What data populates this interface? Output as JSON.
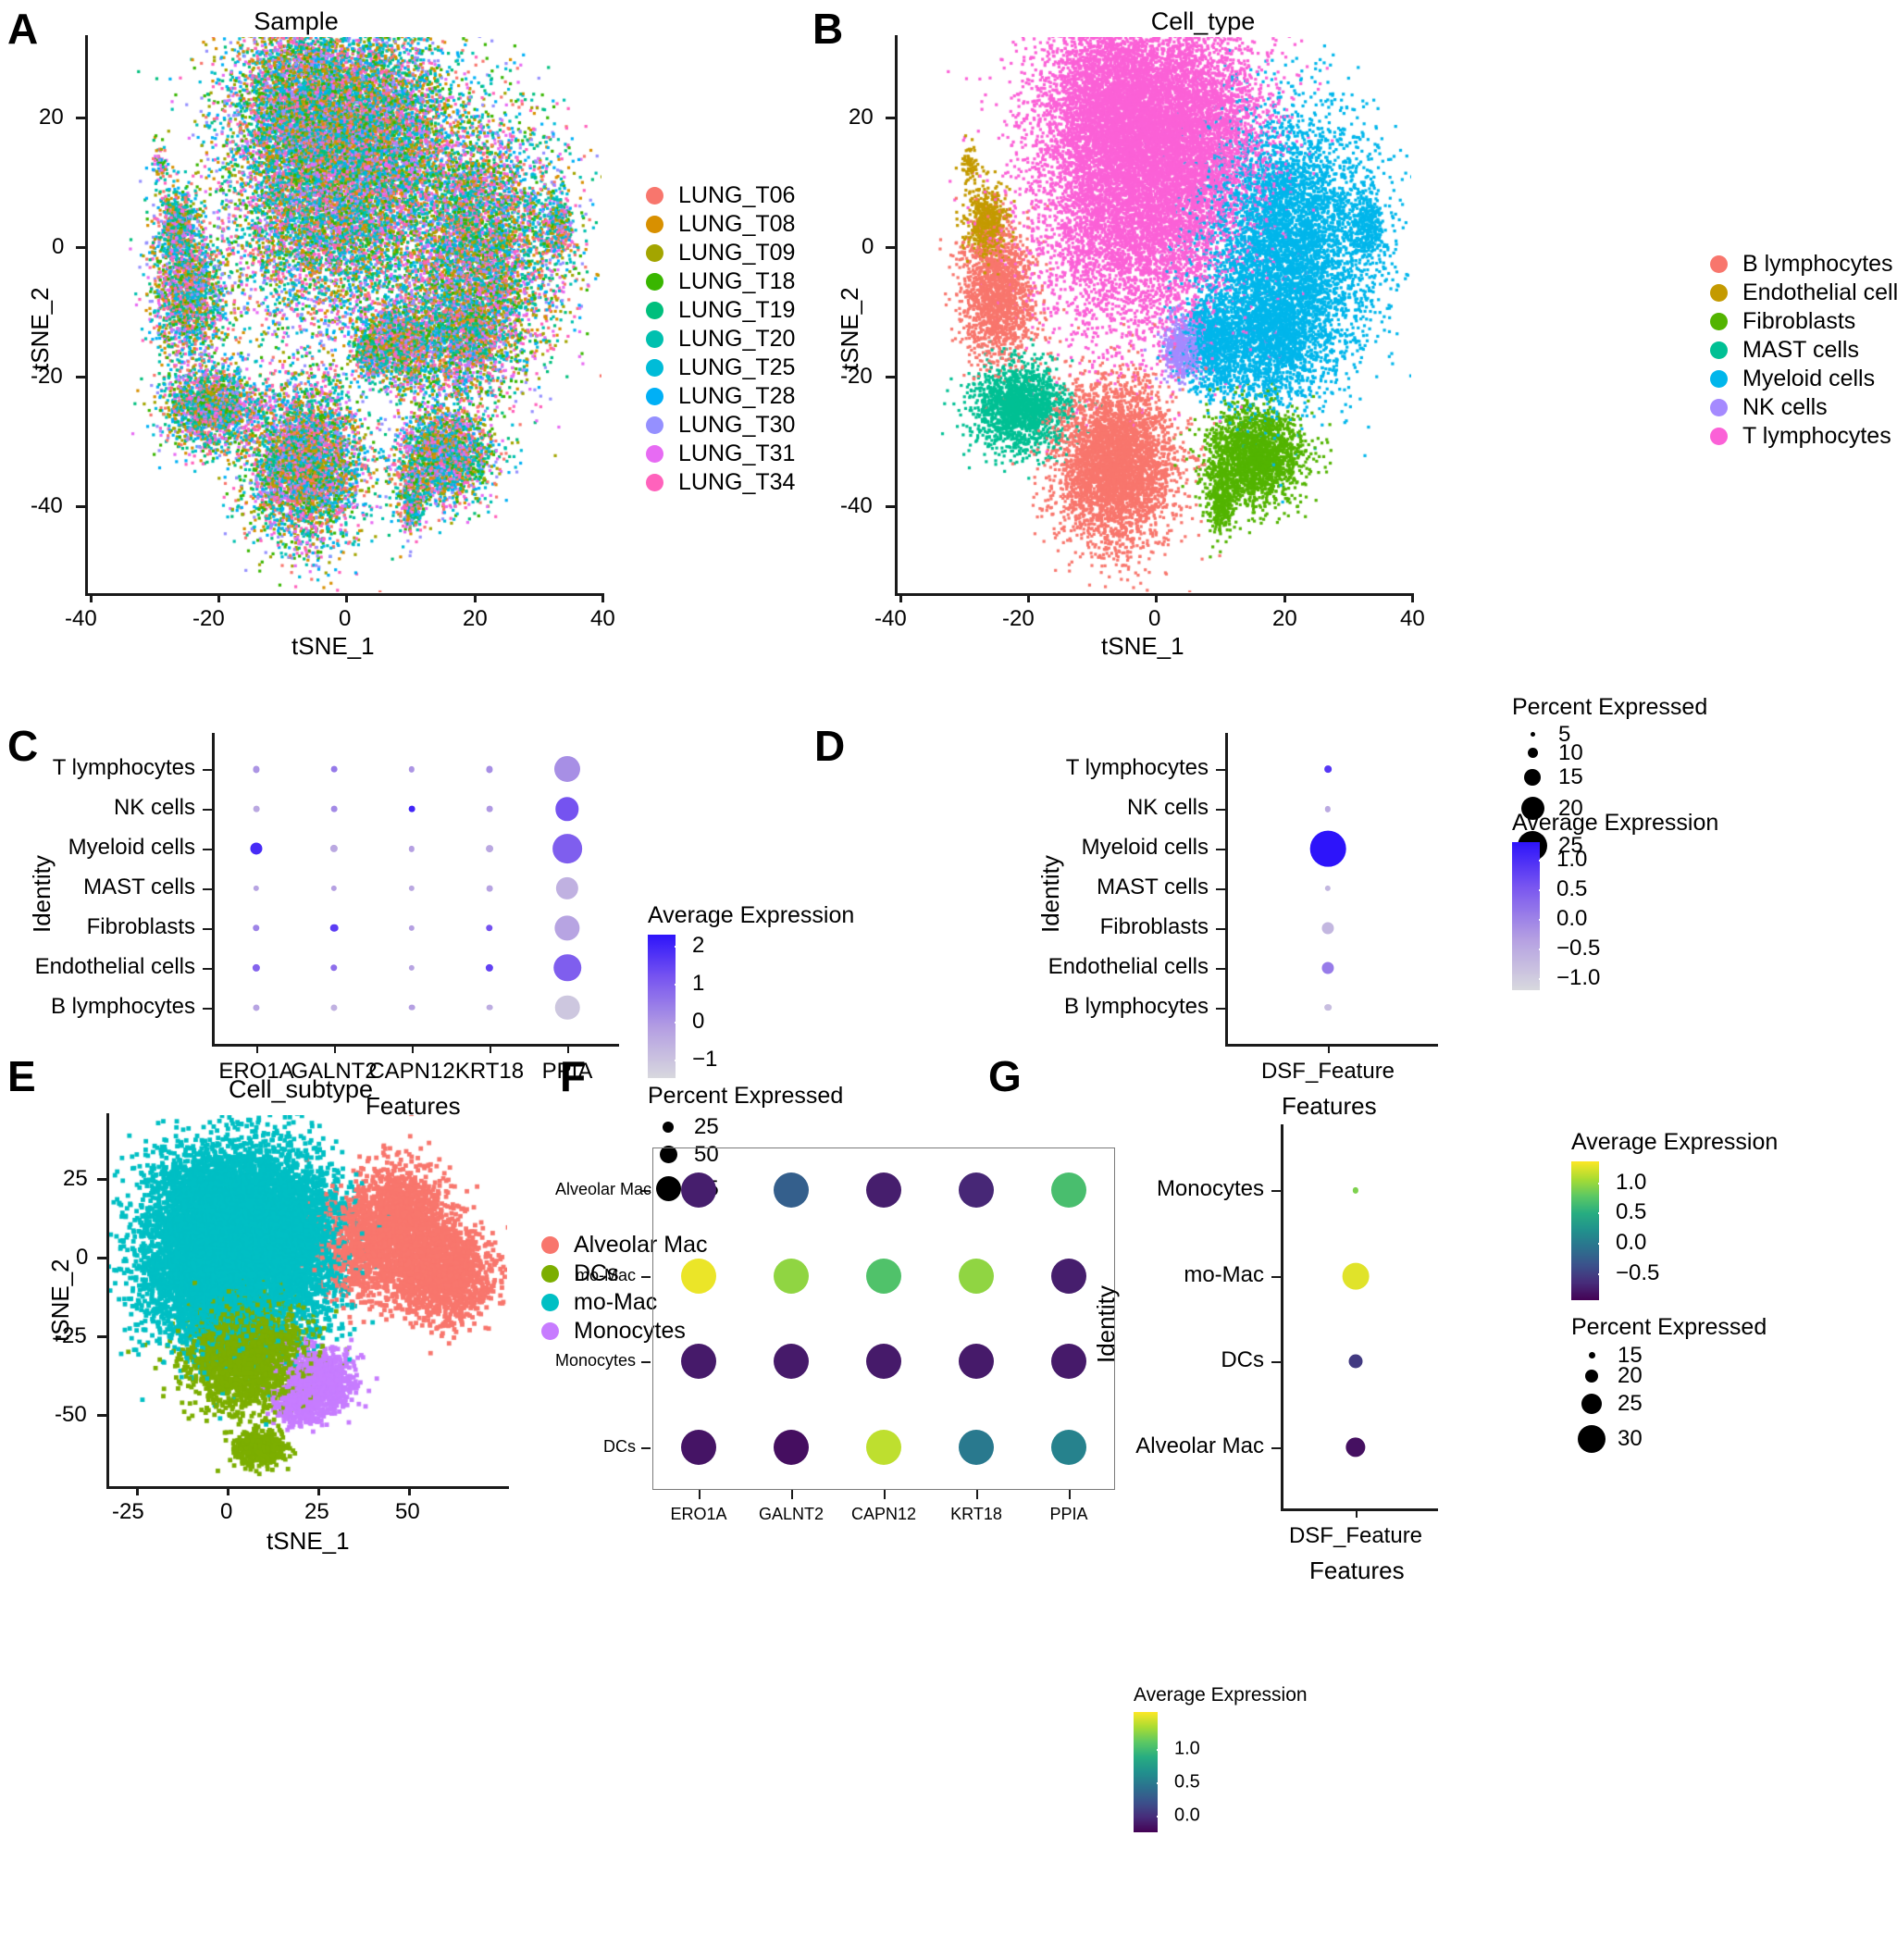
{
  "figure": {
    "panels": [
      "A",
      "B",
      "C",
      "D",
      "E",
      "F",
      "G"
    ]
  },
  "panelA": {
    "letter": "A",
    "title": "Sample",
    "xlabel": "tSNE_1",
    "ylabel": "tSNE_2",
    "xticks": [
      "-40",
      "-20",
      "0",
      "20",
      "40"
    ],
    "yticks": [
      "20",
      "0",
      "-20",
      "-40"
    ],
    "legend_items": [
      {
        "label": "LUNG_T06",
        "color": "#F8766D"
      },
      {
        "label": "LUNG_T08",
        "color": "#D89000"
      },
      {
        "label": "LUNG_T09",
        "color": "#A3A500"
      },
      {
        "label": "LUNG_T18",
        "color": "#39B600"
      },
      {
        "label": "LUNG_T19",
        "color": "#00BF7D"
      },
      {
        "label": "LUNG_T20",
        "color": "#00C0AF"
      },
      {
        "label": "LUNG_T25",
        "color": "#00BCD8"
      },
      {
        "label": "LUNG_T28",
        "color": "#00B0F6"
      },
      {
        "label": "LUNG_T30",
        "color": "#9590FF"
      },
      {
        "label": "LUNG_T31",
        "color": "#E76BF3"
      },
      {
        "label": "LUNG_T34",
        "color": "#FF62BC"
      }
    ]
  },
  "panelB": {
    "letter": "B",
    "title": "Cell_type",
    "xlabel": "tSNE_1",
    "ylabel": "tSNE_2",
    "xticks": [
      "-40",
      "-20",
      "0",
      "20",
      "40"
    ],
    "yticks": [
      "20",
      "0",
      "-20",
      "-40"
    ],
    "legend_items": [
      {
        "label": "B lymphocytes",
        "color": "#F8766D"
      },
      {
        "label": "Endothelial cells",
        "color": "#C49A00"
      },
      {
        "label": "Fibroblasts",
        "color": "#53B400"
      },
      {
        "label": "MAST cells",
        "color": "#00C094"
      },
      {
        "label": "Myeloid cells",
        "color": "#00B6EB"
      },
      {
        "label": "NK cells",
        "color": "#A58AFF"
      },
      {
        "label": "T lymphocytes",
        "color": "#FB61D7"
      }
    ]
  },
  "panelC": {
    "letter": "C",
    "xlabel": "Features",
    "ylabel": "Identity",
    "features": [
      "ERO1A",
      "GALNT2",
      "CAPN12",
      "KRT18",
      "PPIA"
    ],
    "identities": [
      "B lymphocytes",
      "Endothelial cells",
      "Fibroblasts",
      "MAST cells",
      "Myeloid cells",
      "NK cells",
      "T lymphocytes"
    ],
    "color_legend_title": "Average Expression",
    "color_ticks": [
      "2",
      "1",
      "0",
      "-1"
    ],
    "color_range": [
      -1.5,
      2.3
    ],
    "size_legend_title": "Percent Expressed",
    "size_legend_values": [
      "25",
      "50",
      "75"
    ],
    "dots": [
      {
        "identity": "T lymphocytes",
        "feature": "ERO1A",
        "avg": 0.0,
        "pct": 6
      },
      {
        "identity": "T lymphocytes",
        "feature": "GALNT2",
        "avg": 0.5,
        "pct": 5
      },
      {
        "identity": "T lymphocytes",
        "feature": "CAPN12",
        "avg": 0.0,
        "pct": 4
      },
      {
        "identity": "T lymphocytes",
        "feature": "KRT18",
        "avg": 0.1,
        "pct": 6
      },
      {
        "identity": "T lymphocytes",
        "feature": "PPIA",
        "avg": 0.1,
        "pct": 62
      },
      {
        "identity": "NK cells",
        "feature": "ERO1A",
        "avg": -0.4,
        "pct": 5
      },
      {
        "identity": "NK cells",
        "feature": "GALNT2",
        "avg": 0.2,
        "pct": 5
      },
      {
        "identity": "NK cells",
        "feature": "CAPN12",
        "avg": 2.0,
        "pct": 5
      },
      {
        "identity": "NK cells",
        "feature": "KRT18",
        "avg": -0.1,
        "pct": 5
      },
      {
        "identity": "NK cells",
        "feature": "PPIA",
        "avg": 1.2,
        "pct": 55
      },
      {
        "identity": "Myeloid cells",
        "feature": "ERO1A",
        "avg": 1.9,
        "pct": 22
      },
      {
        "identity": "Myeloid cells",
        "feature": "GALNT2",
        "avg": -0.4,
        "pct": 9
      },
      {
        "identity": "Myeloid cells",
        "feature": "CAPN12",
        "avg": -0.2,
        "pct": 4
      },
      {
        "identity": "Myeloid cells",
        "feature": "KRT18",
        "avg": -0.4,
        "pct": 8
      },
      {
        "identity": "Myeloid cells",
        "feature": "PPIA",
        "avg": 1.0,
        "pct": 72
      },
      {
        "identity": "MAST cells",
        "feature": "ERO1A",
        "avg": -0.3,
        "pct": 4
      },
      {
        "identity": "MAST cells",
        "feature": "GALNT2",
        "avg": -0.2,
        "pct": 4
      },
      {
        "identity": "MAST cells",
        "feature": "CAPN12",
        "avg": -0.4,
        "pct": 4
      },
      {
        "identity": "MAST cells",
        "feature": "KRT18",
        "avg": -0.3,
        "pct": 5
      },
      {
        "identity": "MAST cells",
        "feature": "PPIA",
        "avg": -0.6,
        "pct": 52
      },
      {
        "identity": "Fibroblasts",
        "feature": "ERO1A",
        "avg": 0.3,
        "pct": 7
      },
      {
        "identity": "Fibroblasts",
        "feature": "GALNT2",
        "avg": 1.6,
        "pct": 10
      },
      {
        "identity": "Fibroblasts",
        "feature": "CAPN12",
        "avg": -0.2,
        "pct": 4
      },
      {
        "identity": "Fibroblasts",
        "feature": "KRT18",
        "avg": 1.2,
        "pct": 7
      },
      {
        "identity": "Fibroblasts",
        "feature": "PPIA",
        "avg": -0.3,
        "pct": 60
      },
      {
        "identity": "Endothelial cells",
        "feature": "ERO1A",
        "avg": 0.9,
        "pct": 9
      },
      {
        "identity": "Endothelial cells",
        "feature": "GALNT2",
        "avg": 0.7,
        "pct": 7
      },
      {
        "identity": "Endothelial cells",
        "feature": "CAPN12",
        "avg": -0.3,
        "pct": 4
      },
      {
        "identity": "Endothelial cells",
        "feature": "KRT18",
        "avg": 1.5,
        "pct": 9
      },
      {
        "identity": "Endothelial cells",
        "feature": "PPIA",
        "avg": 1.0,
        "pct": 66
      },
      {
        "identity": "B lymphocytes",
        "feature": "ERO1A",
        "avg": -0.3,
        "pct": 6
      },
      {
        "identity": "B lymphocytes",
        "feature": "GALNT2",
        "avg": -0.6,
        "pct": 6
      },
      {
        "identity": "B lymphocytes",
        "feature": "CAPN12",
        "avg": -0.2,
        "pct": 5
      },
      {
        "identity": "B lymphocytes",
        "feature": "KRT18",
        "avg": -0.5,
        "pct": 5
      },
      {
        "identity": "B lymphocytes",
        "feature": "PPIA",
        "avg": -1.1,
        "pct": 58
      }
    ]
  },
  "panelD": {
    "letter": "D",
    "xlabel": "Features",
    "ylabel": "Identity",
    "features": [
      "DSF_Feature"
    ],
    "identities": [
      "B lymphocytes",
      "Endothelial cells",
      "Fibroblasts",
      "MAST cells",
      "Myeloid cells",
      "NK cells",
      "T lymphocytes"
    ],
    "size_legend_title": "Percent Expressed",
    "size_legend_values": [
      "5",
      "10",
      "15",
      "20",
      "25"
    ],
    "color_legend_title": "Average Expression",
    "color_ticks": [
      "1.0",
      "0.5",
      "0.0",
      "-0.5",
      "-1.0"
    ],
    "color_range": [
      -1.2,
      1.3
    ],
    "dots": [
      {
        "identity": "T lymphocytes",
        "avg": 0.9,
        "pct": 3
      },
      {
        "identity": "NK cells",
        "avg": -0.5,
        "pct": 2
      },
      {
        "identity": "Myeloid cells",
        "avg": 1.3,
        "pct": 26
      },
      {
        "identity": "MAST cells",
        "avg": -0.7,
        "pct": 2
      },
      {
        "identity": "Fibroblasts",
        "avg": -0.7,
        "pct": 7
      },
      {
        "identity": "Endothelial cells",
        "avg": 0.1,
        "pct": 7
      },
      {
        "identity": "B lymphocytes",
        "avg": -0.8,
        "pct": 3
      }
    ]
  },
  "panelE": {
    "letter": "E",
    "title": "Cell_subtype",
    "xlabel": "tSNE_1",
    "ylabel": "tSNE_2",
    "xticks": [
      "-25",
      "0",
      "25",
      "50"
    ],
    "yticks": [
      "25",
      "0",
      "-25",
      "-50"
    ],
    "legend_items": [
      {
        "label": "Alveolar Mac",
        "color": "#F8766D"
      },
      {
        "label": "DCs",
        "color": "#7CAE00"
      },
      {
        "label": "mo-Mac",
        "color": "#00BFC4"
      },
      {
        "label": "Monocytes",
        "color": "#C77CFF"
      }
    ]
  },
  "panelF": {
    "letter": "F",
    "features": [
      "ERO1A",
      "GALNT2",
      "CAPN12",
      "KRT18",
      "PPIA"
    ],
    "identities": [
      "DCs",
      "Monocytes",
      "mo-Mac",
      "Alveolar Mac"
    ],
    "color_legend_title": "Average Expression",
    "color_ticks": [
      "1.0",
      "0.5",
      "0.0"
    ],
    "color_range": [
      -0.25,
      1.55
    ],
    "dots": [
      {
        "identity": "Alveolar Mac",
        "feature": "ERO1A",
        "avg": -0.1
      },
      {
        "identity": "Alveolar Mac",
        "feature": "GALNT2",
        "avg": 0.3
      },
      {
        "identity": "Alveolar Mac",
        "feature": "CAPN12",
        "avg": -0.1
      },
      {
        "identity": "Alveolar Mac",
        "feature": "KRT18",
        "avg": -0.05
      },
      {
        "identity": "Alveolar Mac",
        "feature": "PPIA",
        "avg": 1.02
      },
      {
        "identity": "mo-Mac",
        "feature": "ERO1A",
        "avg": 1.5
      },
      {
        "identity": "mo-Mac",
        "feature": "GALNT2",
        "avg": 1.25
      },
      {
        "identity": "mo-Mac",
        "feature": "CAPN12",
        "avg": 1.05
      },
      {
        "identity": "mo-Mac",
        "feature": "KRT18",
        "avg": 1.25
      },
      {
        "identity": "mo-Mac",
        "feature": "PPIA",
        "avg": -0.1
      },
      {
        "identity": "Monocytes",
        "feature": "ERO1A",
        "avg": -0.12
      },
      {
        "identity": "Monocytes",
        "feature": "GALNT2",
        "avg": -0.12
      },
      {
        "identity": "Monocytes",
        "feature": "CAPN12",
        "avg": -0.12
      },
      {
        "identity": "Monocytes",
        "feature": "KRT18",
        "avg": -0.12
      },
      {
        "identity": "Monocytes",
        "feature": "PPIA",
        "avg": -0.12
      },
      {
        "identity": "DCs",
        "feature": "ERO1A",
        "avg": -0.15
      },
      {
        "identity": "DCs",
        "feature": "GALNT2",
        "avg": -0.18
      },
      {
        "identity": "DCs",
        "feature": "CAPN12",
        "avg": 1.38
      },
      {
        "identity": "DCs",
        "feature": "KRT18",
        "avg": 0.48
      },
      {
        "identity": "DCs",
        "feature": "PPIA",
        "avg": 0.55
      }
    ]
  },
  "panelG": {
    "letter": "G",
    "xlabel": "Features",
    "ylabel": "Identity",
    "features": [
      "DSF_Feature"
    ],
    "identities": [
      "Alveolar Mac",
      "DCs",
      "mo-Mac",
      "Monocytes"
    ],
    "color_legend_title": "Average Expression",
    "color_ticks": [
      "1.0",
      "0.5",
      "0.0",
      "-0.5"
    ],
    "color_range": [
      -0.95,
      1.35
    ],
    "size_legend_title": "Percent Expressed",
    "size_legend_values": [
      "15",
      "20",
      "25",
      "30"
    ],
    "dots": [
      {
        "identity": "Monocytes",
        "avg": 0.9,
        "pct": 13
      },
      {
        "identity": "mo-Mac",
        "avg": 1.25,
        "pct": 31
      },
      {
        "identity": "DCs",
        "avg": -0.55,
        "pct": 20
      },
      {
        "identity": "Alveolar Mac",
        "avg": -0.85,
        "pct": 25
      }
    ]
  },
  "chart_data": {
    "type": "scatter",
    "description": "Multi-panel single-cell RNA-seq figure: tSNE scatter embeddings (A, B, E) and dot plots of gene expression by cell identity (C, D, F, G)",
    "panels": [
      {
        "id": "A",
        "type": "scatter",
        "title": "Sample",
        "xlabel": "tSNE_1",
        "ylabel": "tSNE_2",
        "xlim": [
          -45,
          45
        ],
        "ylim": [
          -45,
          33
        ],
        "legend_position": "right",
        "grid": false,
        "groups": [
          "LUNG_T06",
          "LUNG_T08",
          "LUNG_T09",
          "LUNG_T18",
          "LUNG_T19",
          "LUNG_T20",
          "LUNG_T25",
          "LUNG_T28",
          "LUNG_T30",
          "LUNG_T31",
          "LUNG_T34"
        ]
      },
      {
        "id": "B",
        "type": "scatter",
        "title": "Cell_type",
        "xlabel": "tSNE_1",
        "ylabel": "tSNE_2",
        "xlim": [
          -45,
          45
        ],
        "ylim": [
          -45,
          33
        ],
        "legend_position": "right",
        "grid": false,
        "groups": [
          "B lymphocytes",
          "Endothelial cells",
          "Fibroblasts",
          "MAST cells",
          "Myeloid cells",
          "NK cells",
          "T lymphocytes"
        ]
      },
      {
        "id": "C",
        "type": "scatter",
        "xlabel": "Features",
        "ylabel": "Identity",
        "grid": false,
        "categories": [
          "ERO1A",
          "GALNT2",
          "CAPN12",
          "KRT18",
          "PPIA"
        ],
        "rows": [
          "B lymphocytes",
          "Endothelial cells",
          "Fibroblasts",
          "MAST cells",
          "Myeloid cells",
          "NK cells",
          "T lymphocytes"
        ],
        "color_scale": "white-blue",
        "color_range": [
          -1,
          2
        ],
        "size_range": [
          25,
          75
        ]
      },
      {
        "id": "D",
        "type": "scatter",
        "xlabel": "Features",
        "ylabel": "Identity",
        "grid": false,
        "categories": [
          "DSF_Feature"
        ],
        "rows": [
          "B lymphocytes",
          "Endothelial cells",
          "Fibroblasts",
          "MAST cells",
          "Myeloid cells",
          "NK cells",
          "T lymphocytes"
        ],
        "color_scale": "white-blue",
        "color_range": [
          -1.0,
          1.0
        ],
        "size_range": [
          5,
          25
        ]
      },
      {
        "id": "E",
        "type": "scatter",
        "title": "Cell_subtype",
        "xlabel": "tSNE_1",
        "ylabel": "tSNE_2",
        "xlim": [
          -42,
          55
        ],
        "ylim": [
          -55,
          45
        ],
        "legend_position": "right",
        "grid": false,
        "groups": [
          "Alveolar Mac",
          "DCs",
          "mo-Mac",
          "Monocytes"
        ]
      },
      {
        "id": "F",
        "type": "scatter",
        "grid": false,
        "categories": [
          "ERO1A",
          "GALNT2",
          "CAPN12",
          "KRT18",
          "PPIA"
        ],
        "rows": [
          "DCs",
          "Monocytes",
          "mo-Mac",
          "Alveolar Mac"
        ],
        "color_scale": "viridis",
        "color_range": [
          0.0,
          1.0
        ]
      },
      {
        "id": "G",
        "type": "scatter",
        "xlabel": "Features",
        "ylabel": "Identity",
        "grid": false,
        "categories": [
          "DSF_Feature"
        ],
        "rows": [
          "Alveolar Mac",
          "DCs",
          "mo-Mac",
          "Monocytes"
        ],
        "color_scale": "viridis",
        "color_range": [
          -0.5,
          1.0
        ],
        "size_range": [
          15,
          30
        ]
      }
    ]
  }
}
